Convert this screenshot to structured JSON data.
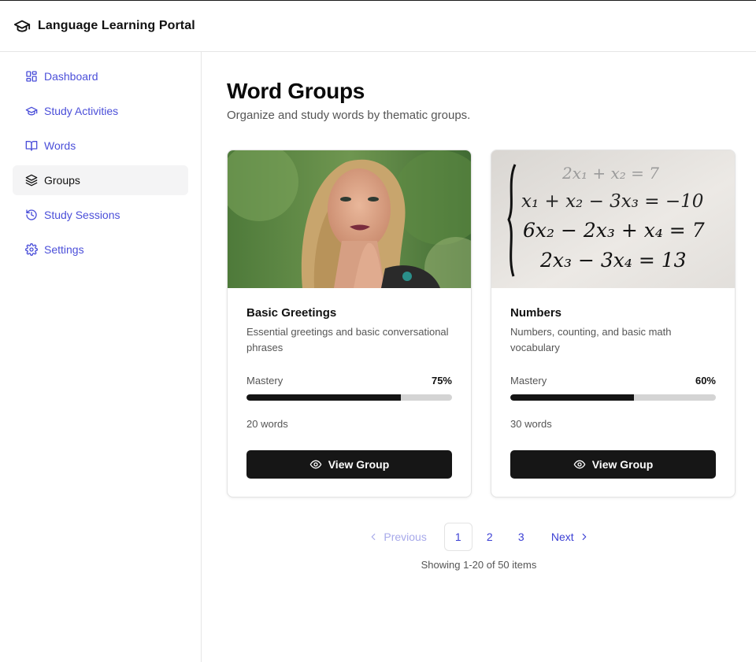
{
  "app": {
    "title": "Language Learning Portal",
    "icon": "graduation-cap-icon"
  },
  "sidebar": {
    "items": [
      {
        "label": "Dashboard",
        "icon": "layout-dashboard-icon"
      },
      {
        "label": "Study Activities",
        "icon": "graduation-cap-icon"
      },
      {
        "label": "Words",
        "icon": "book-open-icon"
      },
      {
        "label": "Groups",
        "icon": "layers-icon",
        "active": true
      },
      {
        "label": "Study Sessions",
        "icon": "history-icon"
      },
      {
        "label": "Settings",
        "icon": "settings-icon"
      }
    ]
  },
  "main": {
    "title": "Word Groups",
    "subtitle": "Organize and study words by thematic groups.",
    "groups": [
      {
        "title": "Basic Greetings",
        "description": "Essential greetings and basic conversational phrases",
        "mastery_label": "Mastery",
        "mastery_value": "75%",
        "mastery_fraction": 0.75,
        "words": "20 words",
        "button_label": "View Group"
      },
      {
        "title": "Numbers",
        "description": "Numbers, counting, and basic math vocabulary",
        "mastery_label": "Mastery",
        "mastery_value": "60%",
        "mastery_fraction": 0.6,
        "words": "30 words",
        "button_label": "View Group",
        "image_equations": [
          "2x₁ + x₂ = 7",
          "x₁ + x₂ − 3x₃ = −10",
          "6x₂ − 2x₃ + x₄ = 7",
          "2x₃ − 3x₄ = 13"
        ]
      }
    ]
  },
  "pagination": {
    "previous": "Previous",
    "next": "Next",
    "pages": [
      "1",
      "2",
      "3"
    ],
    "current_page": "1",
    "showing": "Showing 1-20 of 50 items"
  },
  "colors": {
    "accent": "#4b4fd9",
    "button": "#161616",
    "progress_track": "#d4d4d4",
    "progress_fill": "#141414"
  }
}
